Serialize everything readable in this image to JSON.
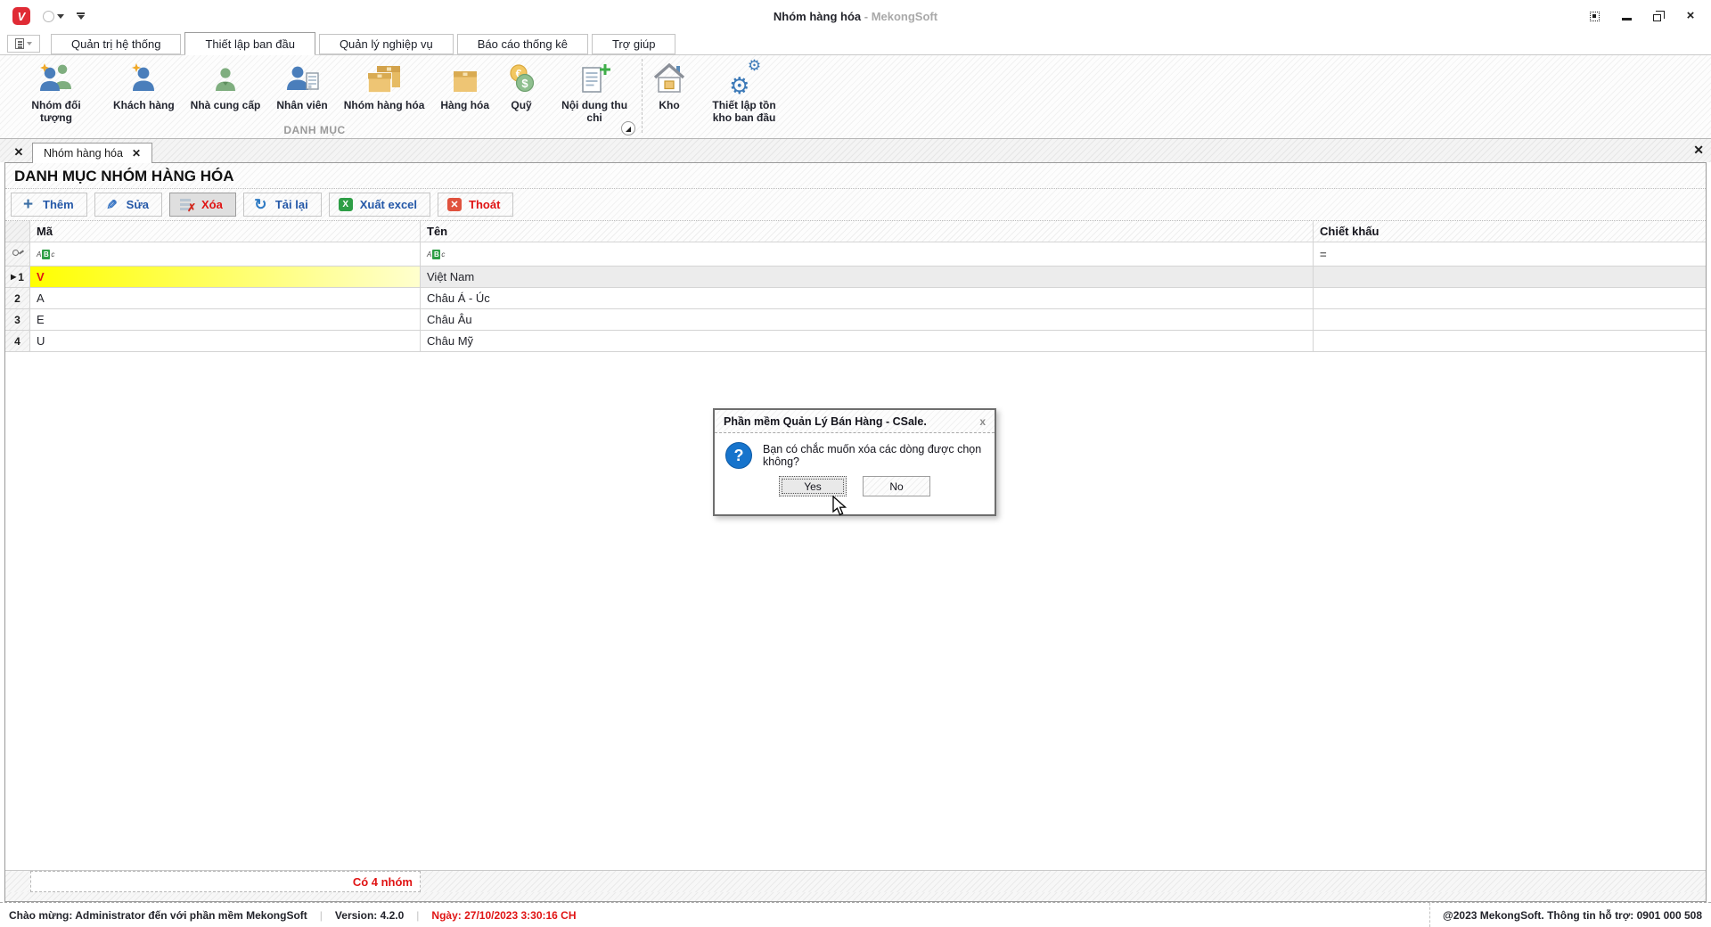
{
  "titlebar": {
    "title": "Nhóm hàng hóa",
    "app_suffix": "- MekongSoft",
    "logo_letter": "V"
  },
  "ribbon": {
    "tabs": [
      {
        "label": "Quản trị hệ thống"
      },
      {
        "label": "Thiết lập ban đầu",
        "active": true
      },
      {
        "label": "Quản lý nghiệp vụ"
      },
      {
        "label": "Báo cáo thống kê"
      },
      {
        "label": "Trợ giúp"
      }
    ],
    "group_label": "DANH MỤC",
    "items": [
      {
        "label": "Nhóm đối tượng",
        "icon": "people-group-icon"
      },
      {
        "label": "Khách hàng",
        "icon": "customer-icon"
      },
      {
        "label": "Nhà cung cấp",
        "icon": "supplier-icon"
      },
      {
        "label": "Nhân viên",
        "icon": "employee-icon"
      },
      {
        "label": "Nhóm hàng hóa",
        "icon": "product-group-boxes-icon"
      },
      {
        "label": "Hàng hóa",
        "icon": "product-box-icon"
      },
      {
        "label": "Quỹ",
        "icon": "coins-icon"
      },
      {
        "label": "Nội dung thu chi",
        "icon": "document-plus-icon"
      },
      {
        "label": "Kho",
        "icon": "warehouse-icon"
      },
      {
        "label": "Thiết lập tồn kho ban đầu",
        "icon": "gears-icon"
      }
    ]
  },
  "doc_tabs": {
    "active_label": "Nhóm hàng hóa"
  },
  "page": {
    "title": "DANH MỤC NHÓM HÀNG HÓA"
  },
  "toolbar": {
    "add": "Thêm",
    "edit": "Sửa",
    "delete": "Xóa",
    "reload": "Tải lại",
    "export": "Xuất excel",
    "exit": "Thoát"
  },
  "table": {
    "columns": {
      "code": "Mã",
      "name": "Tên",
      "discount": "Chiết khấu"
    },
    "filter_row": {
      "discount_operator": "="
    },
    "rows": [
      {
        "num": "1",
        "code": "V",
        "name": "Việt Nam",
        "discount": "",
        "selected": true
      },
      {
        "num": "2",
        "code": "A",
        "name": "Châu Á - Úc",
        "discount": ""
      },
      {
        "num": "3",
        "code": "E",
        "name": "Châu Âu",
        "discount": ""
      },
      {
        "num": "4",
        "code": "U",
        "name": "Châu Mỹ",
        "discount": ""
      }
    ],
    "summary": "Có 4 nhóm"
  },
  "dialog": {
    "title": "Phần mềm Quản Lý Bán Hàng - CSale.",
    "message": "Bạn có chắc muốn xóa các dòng được chọn không?",
    "question_mark": "?",
    "yes_label": "Yes",
    "no_label": "No",
    "close_glyph": "x"
  },
  "statusbar": {
    "welcome": "Chào mừng: Administrator đến với phần mềm MekongSoft",
    "version": "Version: 4.2.0",
    "date": "Ngày: 27/10/2023 3:30:16 CH",
    "support": "@2023 MekongSoft. Thông tin hỗ trợ: 0901 000 508",
    "separator": "|"
  },
  "icons": {
    "plus": "+",
    "pencil": "✎",
    "refresh": "↻",
    "excel_x": "X",
    "exit_x": "✕",
    "delete_x": "✗",
    "close_x": "×",
    "tab_close_x": "✕",
    "gear": "⚙",
    "abc_a": "A",
    "abc_b": "B",
    "abc_c": "c"
  },
  "colors": {
    "accent_blue": "#2458a8",
    "danger_red": "#e01414",
    "brand_red": "#e02b35",
    "row_highlight_yellow": "#ffff00",
    "selected_row_gray": "#ececec",
    "icon_blue": "#4a7ebb",
    "icon_green": "#7fae7f",
    "icon_tan": "#e6bb63",
    "dialog_icon_blue": "#1774cc"
  }
}
